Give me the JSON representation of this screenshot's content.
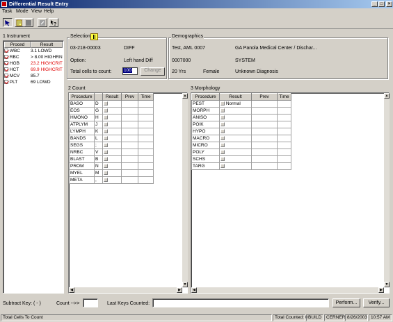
{
  "window": {
    "title": "Differential Result Entry"
  },
  "menu": [
    "Task",
    "Mode",
    "View",
    "Help"
  ],
  "instrument": {
    "label": "Instrument",
    "number": "1",
    "headers": [
      "Proced",
      "Result"
    ],
    "rows": [
      {
        "name": "WBC",
        "result": "3.1 LOWD",
        "red": false
      },
      {
        "name": "RBC",
        "result": "> 8.00 HIGHRN",
        "red": false
      },
      {
        "name": "HGB",
        "result": "23.2 HIGHCRIT",
        "red": true
      },
      {
        "name": "HCT",
        "result": "69.9 HIGHCRIT",
        "red": true
      },
      {
        "name": "MCV",
        "result": "85.7",
        "red": false
      },
      {
        "name": "PLT",
        "result": "69 LOWD",
        "red": false
      }
    ]
  },
  "selection": {
    "label": "Selection",
    "accession": "03-218-00003",
    "type": "DIFF",
    "option_label": "Option:",
    "option_value": "Left hand Diff",
    "total_label": "Total cells to count:",
    "total_value": "100",
    "change_button": "Change"
  },
  "demographics": {
    "label": "Demographics",
    "name": "Test, AML 0007",
    "facility": "GA Panola Medical Center / Dischar...",
    "mrn": "0007000",
    "system": "SYSTEM",
    "age": "20 Yrs",
    "sex": "Female",
    "diagnosis": "Unknown Diagnosis"
  },
  "count": {
    "label": "Count",
    "number": "2",
    "headers": [
      "Procedure",
      "",
      "Result",
      "Prev",
      "Time"
    ],
    "rows": [
      {
        "name": "BASO",
        "key": "D"
      },
      {
        "name": "EOS",
        "key": "G"
      },
      {
        "name": "HMONO",
        "key": "H"
      },
      {
        "name": "ATPLYM",
        "key": "J"
      },
      {
        "name": "LYMPH",
        "key": "K"
      },
      {
        "name": "BANDS",
        "key": "L"
      },
      {
        "name": "SEGS",
        "key": ";"
      },
      {
        "name": "NRBC",
        "key": "V"
      },
      {
        "name": "BLAST",
        "key": "B"
      },
      {
        "name": "PROM",
        "key": "N"
      },
      {
        "name": "MYEL",
        "key": "M"
      },
      {
        "name": "META",
        "key": ","
      }
    ]
  },
  "morphology": {
    "label": "Morphology",
    "number": "3",
    "headers": [
      "Procedure",
      "Result",
      "Prev",
      "Time"
    ],
    "rows": [
      {
        "name": "PEST",
        "result": "Normal"
      },
      {
        "name": "MORPH",
        "result": ""
      },
      {
        "name": "ANISO",
        "result": ""
      },
      {
        "name": "POIK",
        "result": ""
      },
      {
        "name": "HYPO",
        "result": ""
      },
      {
        "name": "MACRO",
        "result": ""
      },
      {
        "name": "MICRO",
        "result": ""
      },
      {
        "name": "POLY",
        "result": ""
      },
      {
        "name": "SCHS",
        "result": ""
      },
      {
        "name": "TARG",
        "result": ""
      }
    ]
  },
  "bottom": {
    "subtract_key": "Subtract Key: ( - )",
    "count_label": "Count -->>",
    "count_value": "",
    "last_keys_label": "Last Keys Counted:",
    "last_keys_value": "",
    "perform_button": "Perform...",
    "verify_button": "Verify..."
  },
  "status": {
    "left": "Total Cells To Count",
    "total_counted": "Total Counted: 0",
    "mode": "BUILD",
    "user": "CERNER",
    "date": "8/26/2003",
    "time": "10:57 AM"
  },
  "colors": {
    "title_start": "#0a246a",
    "title_end": "#a6caf0",
    "critical": "#e00000"
  }
}
